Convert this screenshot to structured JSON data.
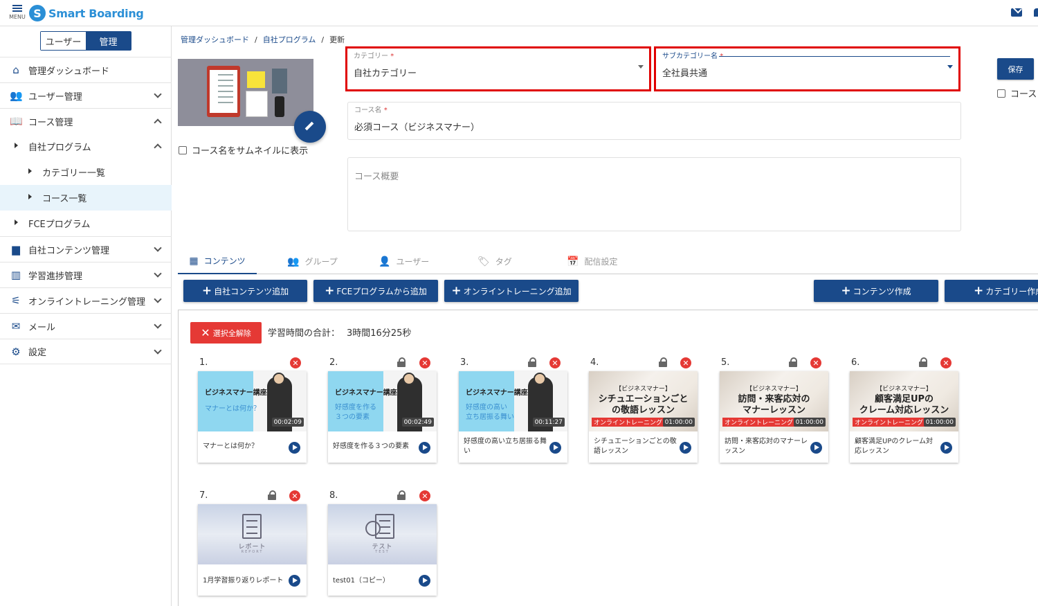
{
  "header": {
    "menu_label": "MENU",
    "logo_mark": "S",
    "logo_text": "Smart Boarding"
  },
  "sidebar": {
    "switch": {
      "user": "ユーザー",
      "admin": "管理"
    },
    "items": [
      {
        "label": "管理ダッシュボード",
        "icon": "home-icon"
      },
      {
        "label": "ユーザー管理",
        "icon": "users-icon"
      },
      {
        "label": "コース管理",
        "icon": "book-icon"
      },
      {
        "label": "自社プログラム"
      },
      {
        "label": "カテゴリー一覧"
      },
      {
        "label": "コース一覧"
      },
      {
        "label": "FCEプログラム"
      },
      {
        "label": "自社コンテンツ管理",
        "icon": "folder-icon"
      },
      {
        "label": "学習進捗管理",
        "icon": "chart-icon"
      },
      {
        "label": "オンライントレーニング管理",
        "icon": "training-icon"
      },
      {
        "label": "メール",
        "icon": "mail-icon"
      },
      {
        "label": "設定",
        "icon": "gear-icon"
      }
    ]
  },
  "breadcrumb": {
    "items": [
      "管理ダッシュボード",
      "自社プログラム"
    ],
    "current": "更新",
    "sep": "/"
  },
  "form": {
    "category": {
      "label": "カテゴリー",
      "required": "*",
      "value": "自社カテゴリー"
    },
    "subcategory": {
      "label": "サブカテゴリー名",
      "required": "*",
      "value": "全社員共通"
    },
    "course_name": {
      "label": "コース名",
      "required": "*",
      "value": "必須コース（ビジネスマナー）"
    },
    "summary_placeholder": "コース概要",
    "thumb_checkbox": "コース名をサムネイルに表示",
    "save": "保存",
    "course_checkbox": "コース"
  },
  "tabs": [
    {
      "label": "コンテンツ",
      "icon": "grid-icon"
    },
    {
      "label": "グループ",
      "icon": "group-add-icon"
    },
    {
      "label": "ユーザー",
      "icon": "user-add-icon"
    },
    {
      "label": "タグ",
      "icon": "tag-icon"
    },
    {
      "label": "配信設定",
      "icon": "calendar-icon"
    }
  ],
  "actions": {
    "add_own": "自社コンテンツ追加",
    "add_fce": "FCEプログラムから追加",
    "add_online": "オンライントレーニング追加",
    "create_content": "コンテンツ作成",
    "create_category": "カテゴリー作成"
  },
  "content": {
    "clear_all": "選択全解除",
    "total_label": "学習時間の合計：",
    "total_value": "3時間16分25秒",
    "cards": [
      {
        "num": "1.",
        "type": "manner",
        "img_title": "ビジネスマナー講座",
        "img_sub": "マナーとは何か？",
        "duration": "00:02:09",
        "title": "マナーとは何か？",
        "locked": false
      },
      {
        "num": "2.",
        "type": "manner",
        "img_title": "ビジネスマナー講座",
        "img_sub": "好感度を作る\n３つの要素",
        "duration": "00:02:49",
        "title": "好感度を作る３つの要素",
        "locked": true
      },
      {
        "num": "3.",
        "type": "manner",
        "img_title": "ビジネスマナー講座",
        "img_sub": "好感度の高い\n立ち居振る舞い",
        "duration": "00:11:27",
        "title": "好感度の高い立ち居振る舞い",
        "locked": true
      },
      {
        "num": "4.",
        "type": "online",
        "img_title": "【ビジネスマナー】",
        "img_sub": "シチュエーションごと\nの敬語レッスン",
        "badge": "オンライントレーニング",
        "duration": "01:00:00",
        "title": "シチュエーションごとの敬語レッスン",
        "locked": true
      },
      {
        "num": "5.",
        "type": "online",
        "img_title": "【ビジネスマナー】",
        "img_sub": "訪問・来客応対の\nマナーレッスン",
        "badge": "オンライントレーニング",
        "duration": "01:00:00",
        "title": "訪問・来客応対のマナーレッスン",
        "locked": true
      },
      {
        "num": "6.",
        "type": "online",
        "img_title": "【ビジネスマナー】",
        "img_sub": "顧客満足UPの\nクレーム対応レッスン",
        "badge": "オンライントレーニング",
        "duration": "01:00:00",
        "title": "顧客満足UPのクレーム対応レッスン",
        "locked": true
      },
      {
        "num": "7.",
        "type": "report",
        "img_title": "レポート",
        "img_sub": "REPORT",
        "title": "1月学習振り返りレポート",
        "locked": true
      },
      {
        "num": "8.",
        "type": "test",
        "img_title": "テスト",
        "img_sub": "TEST",
        "title": "test01（コピー）",
        "locked": true
      }
    ]
  },
  "colors": {
    "primary": "#1a4a8a",
    "danger": "#e53935",
    "highlight": "#e00000",
    "logo": "#2b8fd6"
  }
}
